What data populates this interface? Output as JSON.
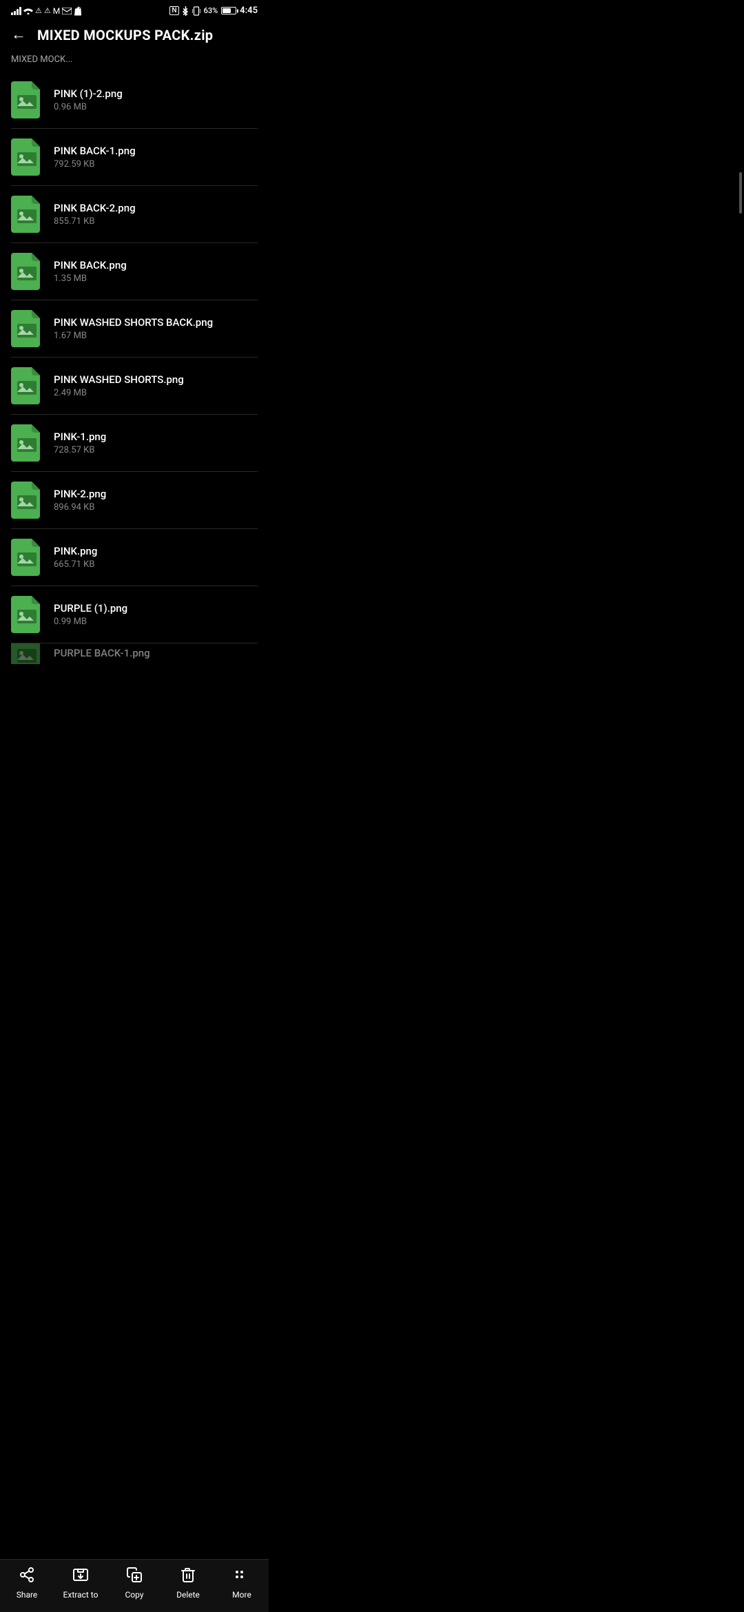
{
  "statusBar": {
    "time": "4:45",
    "battery": "63%",
    "icons_left": [
      "signal",
      "wifi",
      "warning1",
      "warning2",
      "gmail",
      "email",
      "shopify"
    ],
    "icons_right": [
      "nfc",
      "bluetooth",
      "vibrate",
      "battery"
    ]
  },
  "header": {
    "back_label": "←",
    "title": "MIXED MOCKUPS PACK.zip"
  },
  "breadcrumb": "MIXED MOCK...",
  "files": [
    {
      "name": "PINK (1)-2.png",
      "size": "0.96 MB"
    },
    {
      "name": "PINK BACK-1.png",
      "size": "792.59 KB"
    },
    {
      "name": "PINK BACK-2.png",
      "size": "855.71 KB"
    },
    {
      "name": "PINK BACK.png",
      "size": "1.35 MB"
    },
    {
      "name": "PINK WASHED SHORTS BACK.png",
      "size": "1.67 MB"
    },
    {
      "name": "PINK WASHED SHORTS.png",
      "size": "2.49 MB"
    },
    {
      "name": "PINK-1.png",
      "size": "728.57 KB"
    },
    {
      "name": "PINK-2.png",
      "size": "896.94 KB"
    },
    {
      "name": "PINK.png",
      "size": "665.71 KB"
    },
    {
      "name": "PURPLE (1).png",
      "size": "0.99 MB"
    },
    {
      "name": "PURPLE BACK-1.png",
      "size": ""
    }
  ],
  "bottomNav": [
    {
      "id": "share",
      "label": "Share",
      "icon": "share"
    },
    {
      "id": "extract",
      "label": "Extract to",
      "icon": "extract"
    },
    {
      "id": "copy",
      "label": "Copy",
      "icon": "copy"
    },
    {
      "id": "delete",
      "label": "Delete",
      "icon": "delete"
    },
    {
      "id": "more",
      "label": "More",
      "icon": "more"
    }
  ]
}
